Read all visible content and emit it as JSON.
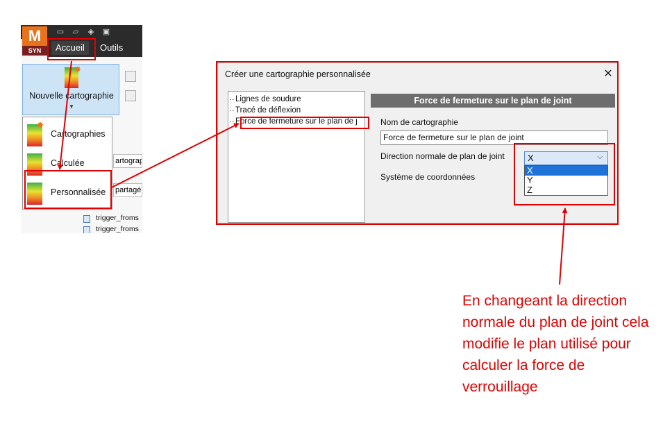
{
  "app": {
    "logo_letter": "M",
    "logo_sub": "SYN",
    "menu_tabs": [
      "Accueil",
      "Outils"
    ]
  },
  "ribbon": {
    "new_map_button": "Nouvelle cartographie",
    "dropdown_items": [
      "Cartographies",
      "Calculée",
      "Personnalisée"
    ],
    "peek_texts": [
      "artograph",
      "partagé"
    ],
    "tree_peek": [
      "trigger_froms",
      "trigger_froms"
    ]
  },
  "dialog": {
    "title": "Créer une cartographie personnalisée",
    "close_glyph": "✕",
    "tree_items": [
      "Lignes de soudure",
      "Tracé de déflexion",
      "Force de fermeture sur le plan de j"
    ],
    "panel_header": "Force de fermeture sur le plan de joint",
    "name_label": "Nom de cartographie",
    "name_value": "Force de fermeture sur le plan de joint",
    "direction_label": "Direction normale de plan de joint",
    "direction_value": "X",
    "direction_options": [
      "X",
      "Y",
      "Z"
    ],
    "coord_label": "Système de coordonnées"
  },
  "annotation": "En changeant la direction normale du plan de joint cela modifie le plan utilisé pour calculer la force de verrouillage",
  "colors": {
    "highlight": "#e00000",
    "accent": "#e8731a",
    "selection": "#1e73d8"
  }
}
